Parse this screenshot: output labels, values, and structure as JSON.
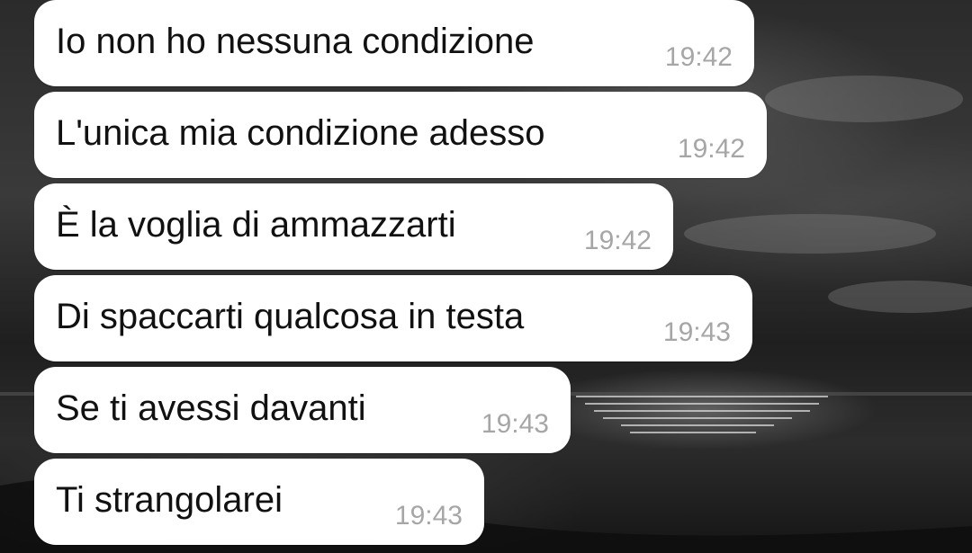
{
  "conversation": {
    "messages": [
      {
        "text": "Io non ho nessuna condizione",
        "time": "19:42"
      },
      {
        "text": "L'unica mia condizione adesso",
        "time": "19:42"
      },
      {
        "text": "È la voglia di ammazzarti",
        "time": "19:42"
      },
      {
        "text": "Di spaccarti qualcosa in testa",
        "time": "19:43"
      },
      {
        "text": "Se ti avessi davanti",
        "time": "19:43"
      },
      {
        "text": "Ti strangolarei",
        "time": "19:43"
      }
    ]
  },
  "colors": {
    "bubble_background": "#ffffff",
    "message_text": "#111111",
    "timestamp_text": "#a6a6a6",
    "wallpaper": "#2a2a2a"
  }
}
